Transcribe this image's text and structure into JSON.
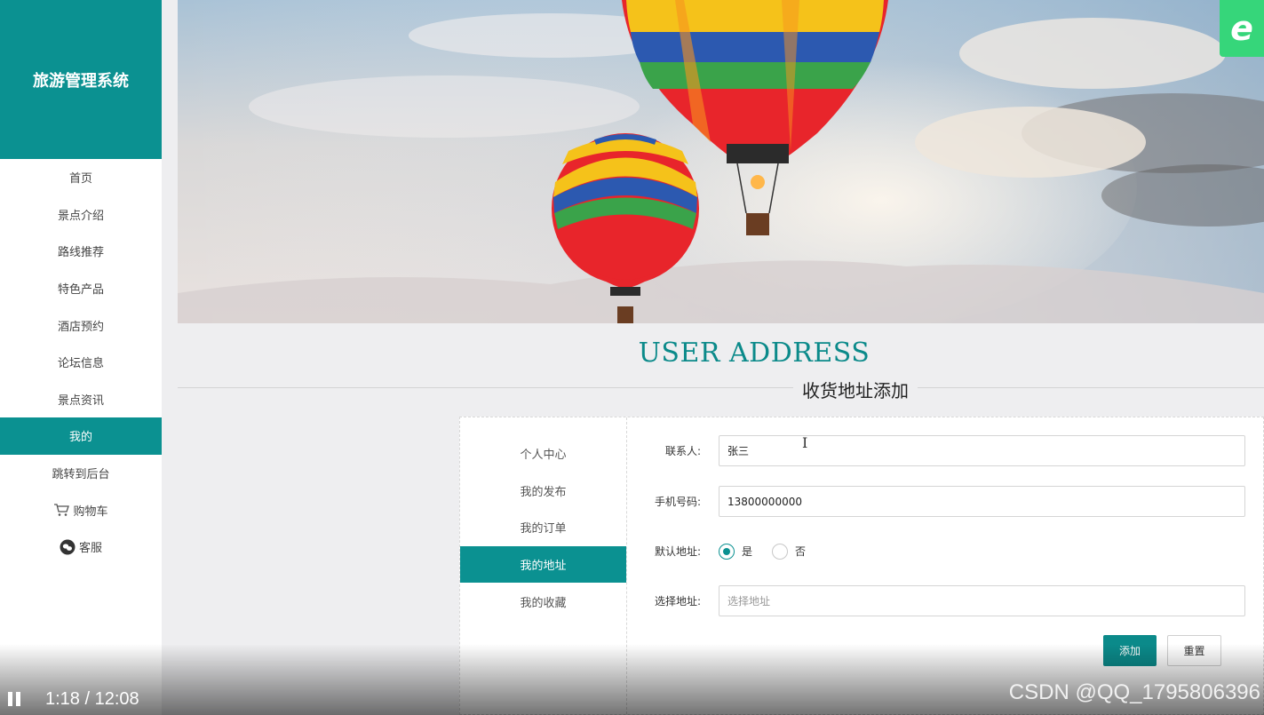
{
  "sidebar": {
    "brand": "旅游管理系统",
    "items": [
      {
        "label": "首页",
        "active": false
      },
      {
        "label": "景点介绍",
        "active": false
      },
      {
        "label": "路线推荐",
        "active": false
      },
      {
        "label": "特色产品",
        "active": false
      },
      {
        "label": "酒店预约",
        "active": false
      },
      {
        "label": "论坛信息",
        "active": false
      },
      {
        "label": "景点资讯",
        "active": false
      },
      {
        "label": "我的",
        "active": true
      },
      {
        "label": "跳转到后台",
        "active": false
      },
      {
        "label": "购物车",
        "icon": "cart-icon",
        "active": false
      },
      {
        "label": "客服",
        "icon": "chat-icon",
        "active": false
      }
    ]
  },
  "banner": {
    "badge_letter": "e",
    "image": "hot-air-balloons"
  },
  "page_title": {
    "en": "USER ADDRESS",
    "cn": "收货地址添加"
  },
  "subnav": {
    "items": [
      {
        "label": "个人中心",
        "active": false
      },
      {
        "label": "我的发布",
        "active": false
      },
      {
        "label": "我的订单",
        "active": false
      },
      {
        "label": "我的地址",
        "active": true
      },
      {
        "label": "我的收藏",
        "active": false
      }
    ]
  },
  "form": {
    "contact": {
      "label": "联系人:",
      "value": "张三"
    },
    "phone": {
      "label": "手机号码:",
      "value": "13800000000"
    },
    "default": {
      "label": "默认地址:",
      "yes": "是",
      "no": "否",
      "selected": "是"
    },
    "address": {
      "label": "选择地址:",
      "placeholder": "选择地址"
    },
    "add_button": "添加",
    "reset_button": "重置"
  },
  "video": {
    "time": "1:18 / 12:08",
    "watermark": "CSDN @QQ_1795806396"
  },
  "colors": {
    "accent": "#0b9191",
    "badge": "#36d67a",
    "background": "#eeeef0"
  }
}
